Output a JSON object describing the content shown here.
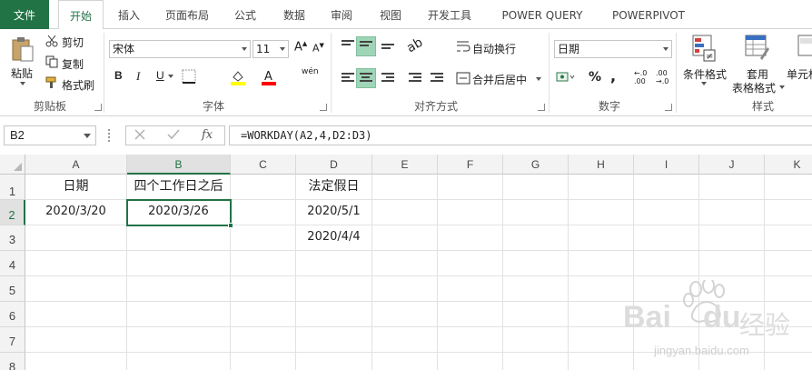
{
  "tabs": [
    "文件",
    "开始",
    "插入",
    "页面布局",
    "公式",
    "数据",
    "审阅",
    "视图",
    "开发工具",
    "POWER QUERY",
    "POWERPIVOT"
  ],
  "ribbon": {
    "clipboard": {
      "paste": "粘贴",
      "cut": "剪切",
      "copy": "复制",
      "format_painter": "格式刷",
      "label": "剪贴板"
    },
    "font": {
      "name": "宋体",
      "size": "11",
      "bold": "B",
      "italic": "I",
      "underline": "U",
      "label": "字体"
    },
    "alignment": {
      "wrap": "自动换行",
      "merge": "合并后居中",
      "label": "对齐方式"
    },
    "number": {
      "format": "日期",
      "percent": "%",
      "comma": ",",
      "label": "数字"
    },
    "styles": {
      "conditional": "条件格式",
      "table_top": "套用",
      "table_bottom": "表格格式",
      "cell_styles": "单元格",
      "label": "样式"
    }
  },
  "formula_bar": {
    "name_box": "B2",
    "formula": "=WORKDAY(A2,4,D2:D3)"
  },
  "columns": [
    "A",
    "B",
    "C",
    "D",
    "E",
    "F",
    "G",
    "H",
    "I",
    "J",
    "K"
  ],
  "rows": [
    "1",
    "2",
    "3",
    "4",
    "5",
    "6",
    "7",
    "8"
  ],
  "cells": {
    "A1": "日期",
    "B1": "四个工作日之后",
    "D1": "法定假日",
    "A2": "2020/3/20",
    "B2": "2020/3/26",
    "D2": "2020/5/1",
    "D3": "2020/4/4"
  },
  "watermark": {
    "brand": "Bai",
    "brand2": "du",
    "cn": "经验",
    "url": "jingyan.baidu.com"
  },
  "colors": {
    "accent": "#217346",
    "selected_button": "#9fd5b7"
  }
}
